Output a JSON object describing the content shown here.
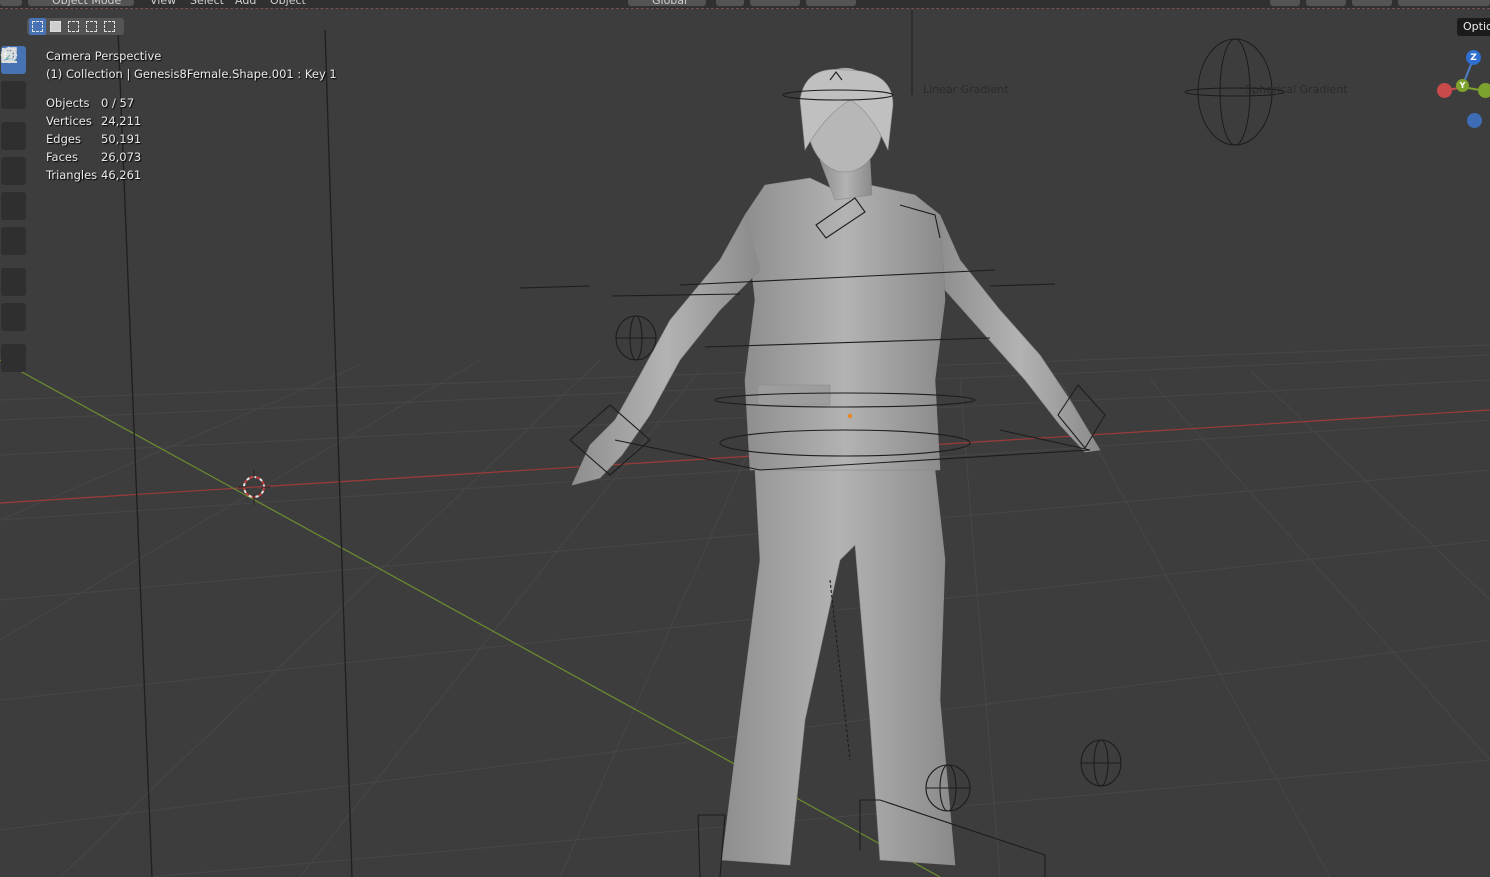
{
  "header": {
    "mode_label": "Object Mode",
    "menu": [
      "View",
      "Select",
      "Add",
      "Object"
    ],
    "orientation_label": "Global"
  },
  "overlay": {
    "view_name": "Camera Perspective",
    "collection_line": "(1) Collection | Genesis8Female.Shape.001 : Key 1",
    "stats": [
      {
        "label": "Objects",
        "value": "0 / 57"
      },
      {
        "label": "Vertices",
        "value": "24,211"
      },
      {
        "label": "Edges",
        "value": "50,191"
      },
      {
        "label": "Faces",
        "value": "26,073"
      },
      {
        "label": "Triangles",
        "value": "46,261"
      }
    ]
  },
  "viewport_labels": {
    "linear_gradient": "Linear Gradient",
    "spherical_gradient": "Spherical Gradient"
  },
  "gizmo": {
    "z_label": "Z",
    "y_label": "Y"
  },
  "tooltip": "Optic",
  "toolbar": {
    "tools": [
      "select-box",
      "cursor",
      "move",
      "rotate",
      "scale",
      "transform",
      "annotate",
      "measure",
      "add-cube"
    ],
    "active_tool": "select-box"
  },
  "colors": {
    "viewport_bg": "#3d3d3d",
    "grid_line": "#474747",
    "x_axis": "#9c3a3a",
    "y_axis": "#6d8f2e",
    "accent": "#4772b3",
    "mesh": "#a9a9a9"
  }
}
